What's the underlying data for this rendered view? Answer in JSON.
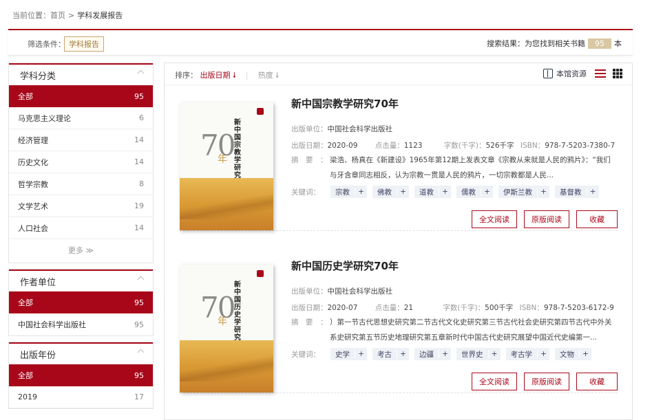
{
  "breadcrumb": {
    "prefix": "当前位置：",
    "home": "首页",
    "sep": ">",
    "current": "学科发展报告"
  },
  "filter": {
    "label": "筛选条件：",
    "tag": "学科报告",
    "result_prefix": "搜索结果：为您找到相关书籍",
    "count": "95",
    "unit": "本"
  },
  "sidebar": {
    "subject": {
      "title": "学科分类",
      "items": [
        {
          "label": "全部",
          "count": "95"
        },
        {
          "label": "马克思主义理论",
          "count": "6"
        },
        {
          "label": "经济管理",
          "count": "14"
        },
        {
          "label": "历史文化",
          "count": "14"
        },
        {
          "label": "哲学宗教",
          "count": "8"
        },
        {
          "label": "文学艺术",
          "count": "19"
        },
        {
          "label": "人口社会",
          "count": "14"
        }
      ],
      "more": "更多"
    },
    "author": {
      "title": "作者单位",
      "items": [
        {
          "label": "全部",
          "count": "95"
        },
        {
          "label": "中国社会科学出版社",
          "count": "95"
        }
      ]
    },
    "year": {
      "title": "出版年份",
      "items": [
        {
          "label": "全部",
          "count": "95"
        },
        {
          "label": "2019",
          "count": "17"
        }
      ]
    }
  },
  "sort": {
    "label": "排序：",
    "date": "出版日期",
    "date_arrow": "🠗",
    "heat": "热度",
    "heat_arrow": "🠗",
    "local": "本馆资源"
  },
  "labels": {
    "publisher": "出版单位：",
    "date": "出版日期：",
    "clicks": "点击量：",
    "words": "字数(千字)：",
    "isbn": "ISBN：",
    "abstract": "摘　要　：",
    "keywords": "关键词："
  },
  "buttons": {
    "fulltext": "全文阅读",
    "original": "原版阅读",
    "collect": "收藏"
  },
  "books": [
    {
      "title": "新中国宗教学研究70年",
      "cover_big": "70",
      "cover_nian": "年",
      "cover_vt": "新中国宗教学研究",
      "publisher": "中国社会科学出版社",
      "date": "2020-09",
      "clicks": "1123",
      "words": "526千字",
      "isbn": "978-7-5203-7380-7",
      "abstract": "梁浩、杨真在《新建设》1965年第12期上发表文章《宗教从来就是人民的鸦片》：“我们与牙含章同志相反，认为宗教一贯是人民的鸦片，一切宗教都是人民...",
      "keywords": [
        "宗教",
        "佛教",
        "道教",
        "儒教",
        "伊斯兰教",
        "基督教"
      ]
    },
    {
      "title": "新中国历史学研究70年",
      "cover_big": "70",
      "cover_nian": "年",
      "cover_vt": "新中国历史学研究",
      "publisher": "中国社会科学出版社",
      "date": "2020-07",
      "clicks": "21",
      "words": "500千字",
      "isbn": "978-7-5203-6172-9",
      "abstract": "）第一节古代思想史研究第二节古代文化史研究第三节古代社会史研究第四节古代中外关系史研究第五节历史地理研究第五章新时代中国古代史研究展望中国近代史编第一...",
      "keywords": [
        "史学",
        "考古",
        "边疆",
        "世界史",
        "考古学",
        "文物"
      ]
    }
  ]
}
